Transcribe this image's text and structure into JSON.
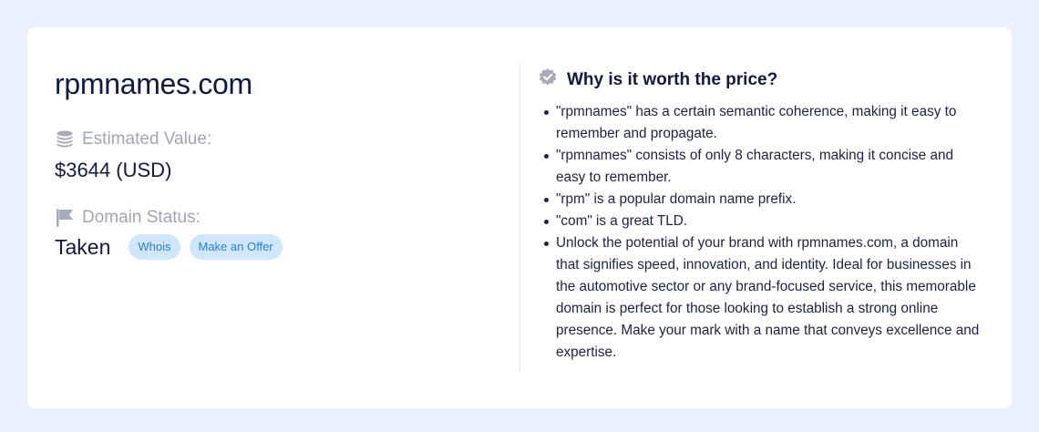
{
  "domain": "rpmnames.com",
  "estimated_value": {
    "icon": "coins-icon",
    "label": "Estimated Value:",
    "value": "$3644 (USD)"
  },
  "domain_status": {
    "icon": "flag-icon",
    "label": "Domain Status:",
    "value": "Taken",
    "whois_label": "Whois",
    "offer_label": "Make an Offer"
  },
  "worth": {
    "icon": "verified-badge-icon",
    "title": "Why is it worth the price?",
    "reasons": [
      "\"rpmnames\" has a certain semantic coherence, making it easy to remember and propagate.",
      "\"rpmnames\" consists of only 8 characters, making it concise and easy to remember.",
      "\"rpm\" is a popular domain name prefix.",
      "\"com\" is a great TLD.",
      "Unlock the potential of your brand with rpmnames.com, a domain that signifies speed, innovation, and identity. Ideal for businesses in the automotive sector or any brand-focused service, this memorable domain is perfect for those looking to establish a strong online presence. Make your mark with a name that conveys excellence and expertise."
    ]
  },
  "colors": {
    "page_background": "#eaf1fd",
    "card_background": "#ffffff",
    "heading_text": "#101a3d",
    "muted_label": "#a0a6b6",
    "pill_background": "#cfe6fb",
    "pill_text": "#2a7fd4",
    "icon_gray": "#a7acb9"
  }
}
